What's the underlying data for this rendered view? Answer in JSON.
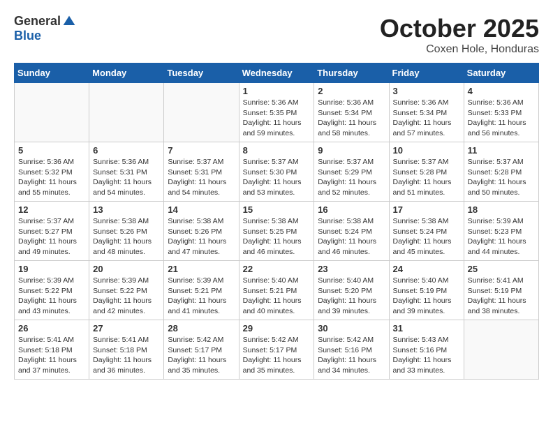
{
  "logo": {
    "general": "General",
    "blue": "Blue"
  },
  "title": "October 2025",
  "subtitle": "Coxen Hole, Honduras",
  "days_of_week": [
    "Sunday",
    "Monday",
    "Tuesday",
    "Wednesday",
    "Thursday",
    "Friday",
    "Saturday"
  ],
  "weeks": [
    [
      {
        "day": "",
        "info": ""
      },
      {
        "day": "",
        "info": ""
      },
      {
        "day": "",
        "info": ""
      },
      {
        "day": "1",
        "info": "Sunrise: 5:36 AM\nSunset: 5:35 PM\nDaylight: 11 hours\nand 59 minutes."
      },
      {
        "day": "2",
        "info": "Sunrise: 5:36 AM\nSunset: 5:34 PM\nDaylight: 11 hours\nand 58 minutes."
      },
      {
        "day": "3",
        "info": "Sunrise: 5:36 AM\nSunset: 5:34 PM\nDaylight: 11 hours\nand 57 minutes."
      },
      {
        "day": "4",
        "info": "Sunrise: 5:36 AM\nSunset: 5:33 PM\nDaylight: 11 hours\nand 56 minutes."
      }
    ],
    [
      {
        "day": "5",
        "info": "Sunrise: 5:36 AM\nSunset: 5:32 PM\nDaylight: 11 hours\nand 55 minutes."
      },
      {
        "day": "6",
        "info": "Sunrise: 5:36 AM\nSunset: 5:31 PM\nDaylight: 11 hours\nand 54 minutes."
      },
      {
        "day": "7",
        "info": "Sunrise: 5:37 AM\nSunset: 5:31 PM\nDaylight: 11 hours\nand 54 minutes."
      },
      {
        "day": "8",
        "info": "Sunrise: 5:37 AM\nSunset: 5:30 PM\nDaylight: 11 hours\nand 53 minutes."
      },
      {
        "day": "9",
        "info": "Sunrise: 5:37 AM\nSunset: 5:29 PM\nDaylight: 11 hours\nand 52 minutes."
      },
      {
        "day": "10",
        "info": "Sunrise: 5:37 AM\nSunset: 5:28 PM\nDaylight: 11 hours\nand 51 minutes."
      },
      {
        "day": "11",
        "info": "Sunrise: 5:37 AM\nSunset: 5:28 PM\nDaylight: 11 hours\nand 50 minutes."
      }
    ],
    [
      {
        "day": "12",
        "info": "Sunrise: 5:37 AM\nSunset: 5:27 PM\nDaylight: 11 hours\nand 49 minutes."
      },
      {
        "day": "13",
        "info": "Sunrise: 5:38 AM\nSunset: 5:26 PM\nDaylight: 11 hours\nand 48 minutes."
      },
      {
        "day": "14",
        "info": "Sunrise: 5:38 AM\nSunset: 5:26 PM\nDaylight: 11 hours\nand 47 minutes."
      },
      {
        "day": "15",
        "info": "Sunrise: 5:38 AM\nSunset: 5:25 PM\nDaylight: 11 hours\nand 46 minutes."
      },
      {
        "day": "16",
        "info": "Sunrise: 5:38 AM\nSunset: 5:24 PM\nDaylight: 11 hours\nand 46 minutes."
      },
      {
        "day": "17",
        "info": "Sunrise: 5:38 AM\nSunset: 5:24 PM\nDaylight: 11 hours\nand 45 minutes."
      },
      {
        "day": "18",
        "info": "Sunrise: 5:39 AM\nSunset: 5:23 PM\nDaylight: 11 hours\nand 44 minutes."
      }
    ],
    [
      {
        "day": "19",
        "info": "Sunrise: 5:39 AM\nSunset: 5:22 PM\nDaylight: 11 hours\nand 43 minutes."
      },
      {
        "day": "20",
        "info": "Sunrise: 5:39 AM\nSunset: 5:22 PM\nDaylight: 11 hours\nand 42 minutes."
      },
      {
        "day": "21",
        "info": "Sunrise: 5:39 AM\nSunset: 5:21 PM\nDaylight: 11 hours\nand 41 minutes."
      },
      {
        "day": "22",
        "info": "Sunrise: 5:40 AM\nSunset: 5:21 PM\nDaylight: 11 hours\nand 40 minutes."
      },
      {
        "day": "23",
        "info": "Sunrise: 5:40 AM\nSunset: 5:20 PM\nDaylight: 11 hours\nand 39 minutes."
      },
      {
        "day": "24",
        "info": "Sunrise: 5:40 AM\nSunset: 5:19 PM\nDaylight: 11 hours\nand 39 minutes."
      },
      {
        "day": "25",
        "info": "Sunrise: 5:41 AM\nSunset: 5:19 PM\nDaylight: 11 hours\nand 38 minutes."
      }
    ],
    [
      {
        "day": "26",
        "info": "Sunrise: 5:41 AM\nSunset: 5:18 PM\nDaylight: 11 hours\nand 37 minutes."
      },
      {
        "day": "27",
        "info": "Sunrise: 5:41 AM\nSunset: 5:18 PM\nDaylight: 11 hours\nand 36 minutes."
      },
      {
        "day": "28",
        "info": "Sunrise: 5:42 AM\nSunset: 5:17 PM\nDaylight: 11 hours\nand 35 minutes."
      },
      {
        "day": "29",
        "info": "Sunrise: 5:42 AM\nSunset: 5:17 PM\nDaylight: 11 hours\nand 35 minutes."
      },
      {
        "day": "30",
        "info": "Sunrise: 5:42 AM\nSunset: 5:16 PM\nDaylight: 11 hours\nand 34 minutes."
      },
      {
        "day": "31",
        "info": "Sunrise: 5:43 AM\nSunset: 5:16 PM\nDaylight: 11 hours\nand 33 minutes."
      },
      {
        "day": "",
        "info": ""
      }
    ]
  ]
}
